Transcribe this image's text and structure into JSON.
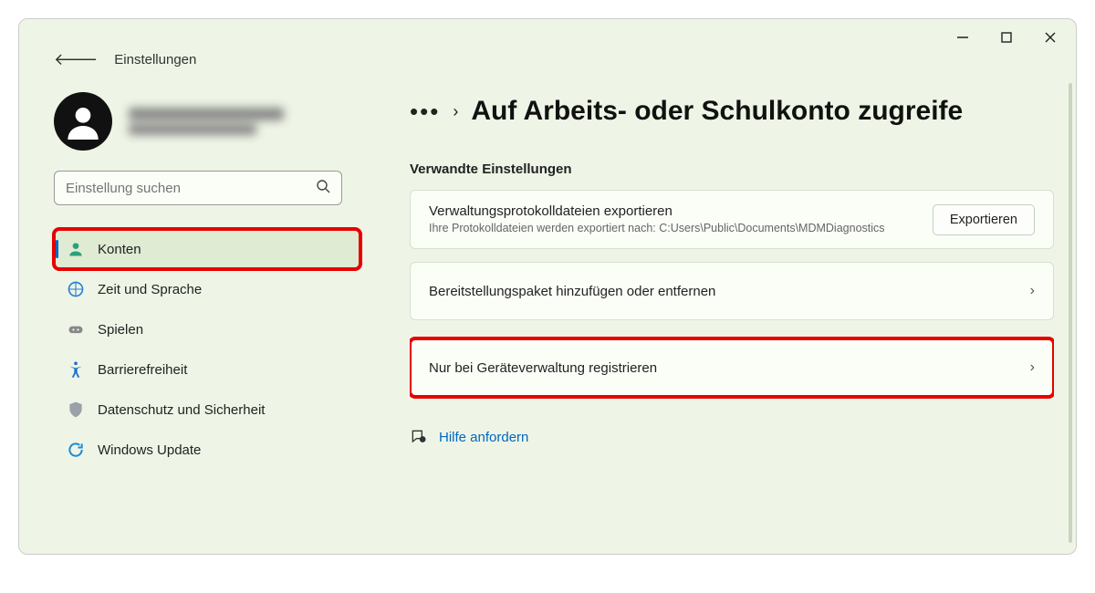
{
  "app": {
    "title": "Einstellungen"
  },
  "search": {
    "placeholder": "Einstellung suchen"
  },
  "nav": {
    "konten": "Konten",
    "zeit": "Zeit und Sprache",
    "spielen": "Spielen",
    "barriere": "Barrierefreiheit",
    "datenschutz": "Datenschutz und Sicherheit",
    "update": "Windows Update"
  },
  "breadcrumb": {
    "title": "Auf Arbeits- oder Schulkonto zugreife"
  },
  "section": {
    "label": "Verwandte Einstellungen"
  },
  "card1": {
    "title": "Verwaltungsprotokolldateien exportieren",
    "sub": "Ihre Protokolldateien werden exportiert nach: C:Users\\Public\\Documents\\MDMDiagnostics",
    "button": "Exportieren"
  },
  "card2": {
    "title": "Bereitstellungspaket hinzufügen oder entfernen"
  },
  "card3": {
    "title": "Nur bei Geräteverwaltung registrieren"
  },
  "help": {
    "label": "Hilfe anfordern"
  }
}
